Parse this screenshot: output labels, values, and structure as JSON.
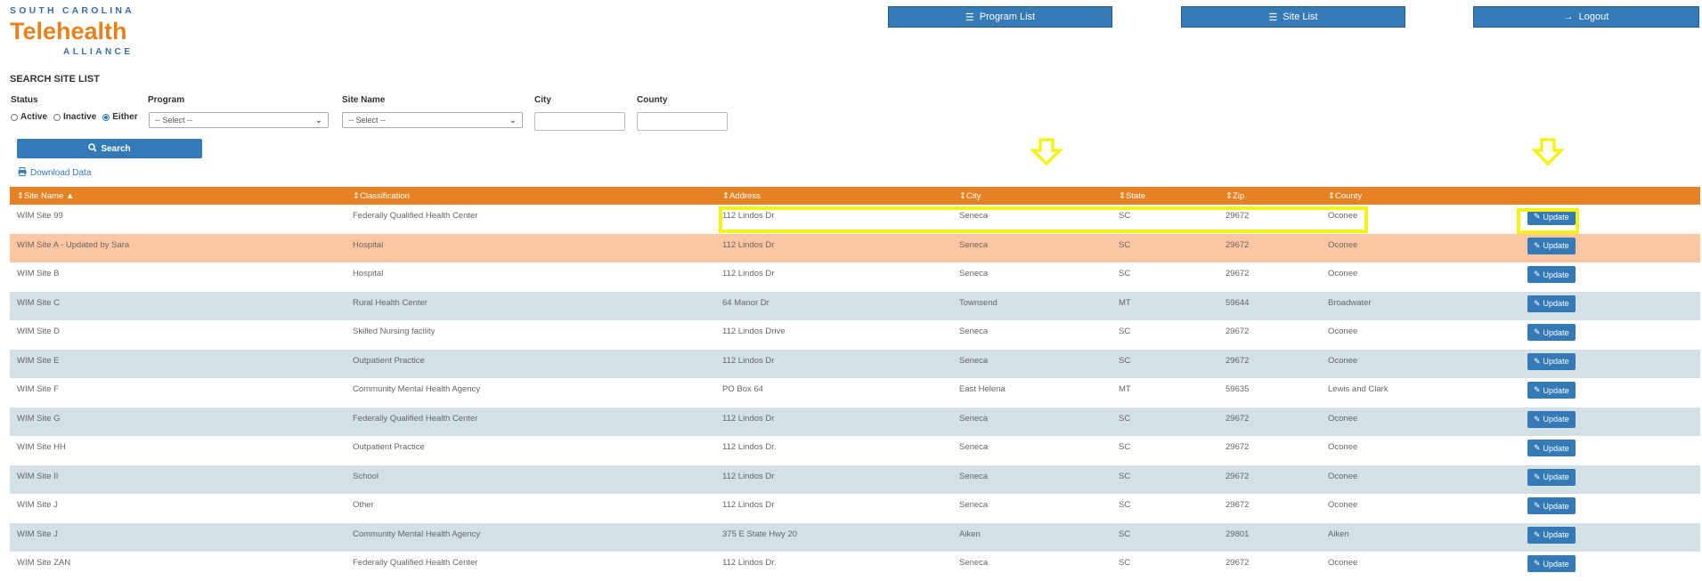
{
  "logo": {
    "line1": "SOUTH CAROLINA",
    "line2": "Telehealth",
    "line3": "ALLIANCE"
  },
  "nav": {
    "program_list": "Program List",
    "site_list": "Site List",
    "logout": "Logout"
  },
  "search": {
    "heading": "SEARCH SITE LIST",
    "status_label": "Status",
    "status_options": [
      "Active",
      "Inactive",
      "Either"
    ],
    "status_selected": "Either",
    "program_label": "Program",
    "program_value": "-- Select --",
    "site_name_label": "Site Name",
    "site_name_value": "-- Select --",
    "city_label": "City",
    "city_value": "",
    "county_label": "County",
    "county_value": "",
    "button": "Search",
    "download": "Download Data"
  },
  "table": {
    "columns": [
      "Site Name",
      "Classification",
      "Address",
      "City",
      "State",
      "Zip",
      "County"
    ],
    "update_label": "Update",
    "rows": [
      [
        "WIM Site 99",
        "Federally Qualified Health Center",
        "112 Lindos Dr",
        "Seneca",
        "SC",
        "29672",
        "Oconee"
      ],
      [
        "WIM Site A - Updated by Sara",
        "Hospital",
        "112 Lindos Dr",
        "Seneca",
        "SC",
        "29672",
        "Oconee"
      ],
      [
        "WIM Site B",
        "Hospital",
        "112 Lindos Dr",
        "Seneca",
        "SC",
        "29672",
        "Oconee"
      ],
      [
        "WIM Site C",
        "Rural Health Center",
        "64 Manor Dr",
        "Townsend",
        "MT",
        "59644",
        "Broadwater"
      ],
      [
        "WIM Site D",
        "Skilled Nursing facility",
        "112 Lindos Drive",
        "Seneca",
        "SC",
        "29672",
        "Oconee"
      ],
      [
        "WIM Site E",
        "Outpatient Practice",
        "112 Lindos Dr",
        "Seneca",
        "SC",
        "29672",
        "Oconee"
      ],
      [
        "WIM Site F",
        "Community Mental Health Agency",
        "PO Box 64",
        "East Helena",
        "MT",
        "59635",
        "Lewis and Clark"
      ],
      [
        "WIM Site G",
        "Federally Qualified Health Center",
        "112 Lindos Dr",
        "Seneca",
        "SC",
        "29672",
        "Oconee"
      ],
      [
        "WIM Site HH",
        "Outpatient Practice",
        "112 Lindos Dr.",
        "Seneca",
        "SC",
        "29672",
        "Oconee"
      ],
      [
        "WIM Site II",
        "School",
        "112 Lindos Dr",
        "Seneca",
        "SC",
        "29672",
        "Oconee"
      ],
      [
        "WIM Site J",
        "Other",
        "112 Lindos Dr",
        "Seneca",
        "SC",
        "29672",
        "Oconee"
      ],
      [
        "WIM Site J",
        "Community Mental Health Agency",
        "375 E State Hwy 20",
        "Aiken",
        "SC",
        "29801",
        "Aiken"
      ],
      [
        "WIM Site ZAN",
        "Federally Qualified Health Center",
        "112 Lindos Dr.",
        "Seneca",
        "SC",
        "29672",
        "Oconee"
      ]
    ],
    "highlight_row": 1
  },
  "colors": {
    "accent": "#337ab7",
    "header": "#e68223",
    "highlight": "#f7f215",
    "row_alt": "#d3e0e6",
    "row_hl": "#fdc6a3"
  },
  "icons": {
    "program_list": "list-icon",
    "site_list": "list-icon",
    "logout": "arrow-right-icon",
    "search": "search-icon",
    "download": "printer-icon",
    "update": "edit-icon",
    "sort": "sort-icon"
  }
}
